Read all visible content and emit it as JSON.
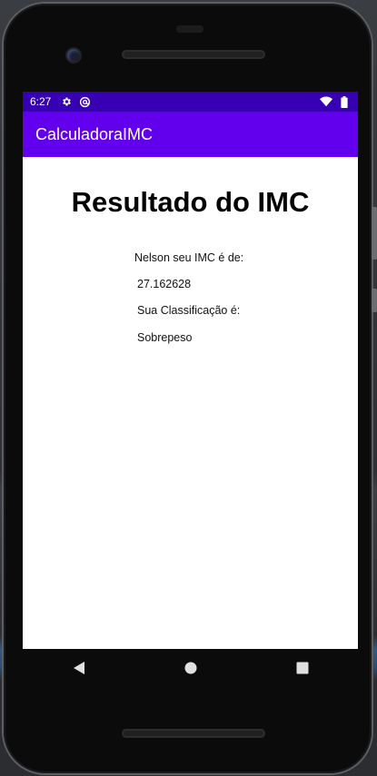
{
  "status_bar": {
    "time": "6:27",
    "icons": [
      "gear-icon",
      "at-sign-icon",
      "wifi-icon",
      "battery-icon"
    ],
    "bg_color": "#3700b3"
  },
  "app_bar": {
    "title": "CalculadoraIMC",
    "bg_color": "#6200ee"
  },
  "result": {
    "title": "Resultado do IMC",
    "intro": "Nelson seu IMC é de:",
    "imc_value": "27.162628",
    "classification_label": "Sua Classificação é:",
    "classification_value": "Sobrepeso"
  },
  "nav": {
    "icons": [
      "back-icon",
      "home-icon",
      "recents-icon"
    ]
  }
}
